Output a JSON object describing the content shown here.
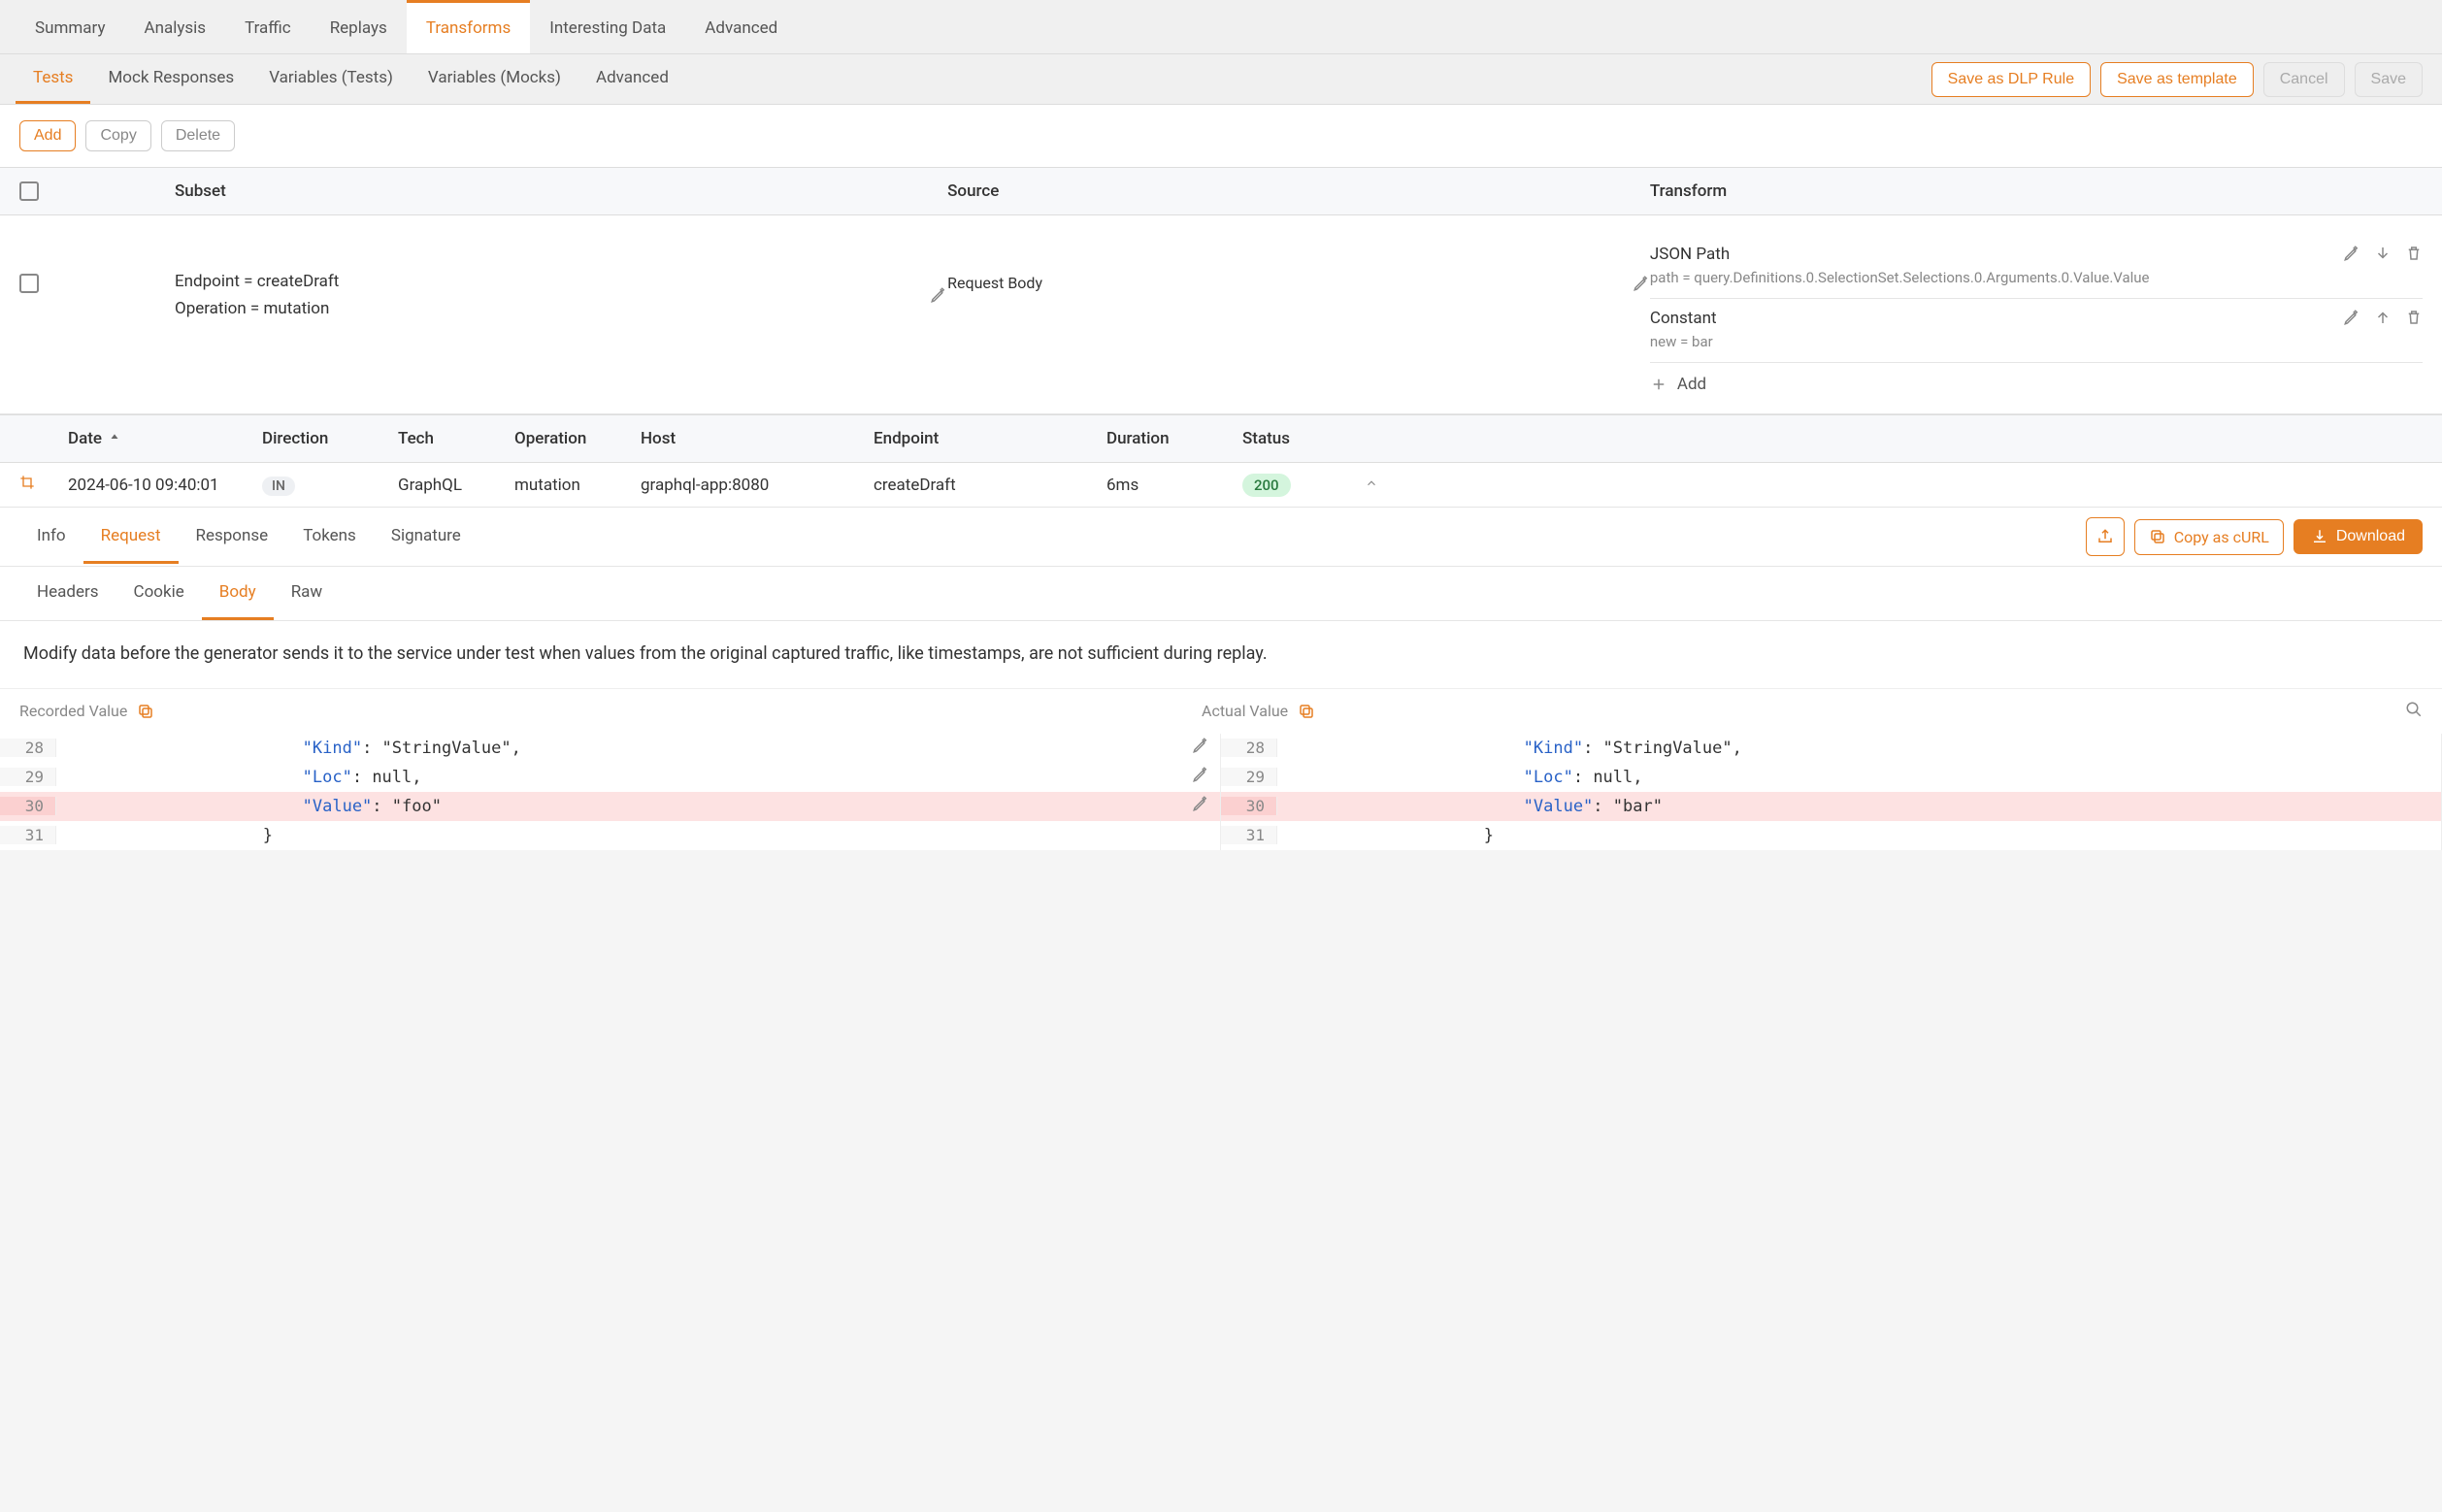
{
  "mainTabs": [
    "Summary",
    "Analysis",
    "Traffic",
    "Replays",
    "Transforms",
    "Interesting Data",
    "Advanced"
  ],
  "mainTabActive": "Transforms",
  "subTabs": [
    "Tests",
    "Mock Responses",
    "Variables (Tests)",
    "Variables (Mocks)",
    "Advanced"
  ],
  "subTabActive": "Tests",
  "actions": {
    "saveDlp": "Save as DLP Rule",
    "saveTemplate": "Save as template",
    "cancel": "Cancel",
    "save": "Save"
  },
  "toolbar": {
    "add": "Add",
    "copy": "Copy",
    "delete": "Delete"
  },
  "tableHeaders": {
    "subset": "Subset",
    "source": "Source",
    "transform": "Transform"
  },
  "row": {
    "subset": {
      "endpoint": "Endpoint = createDraft",
      "operation": "Operation = mutation"
    },
    "source": "Request Body",
    "transforms": [
      {
        "title": "JSON Path",
        "sub": "path = query.Definitions.0.SelectionSet.Selections.0.Arguments.0.Value.Value"
      },
      {
        "title": "Constant",
        "sub": "new = bar"
      }
    ],
    "addLabel": "Add"
  },
  "resultHeaders": {
    "date": "Date",
    "direction": "Direction",
    "tech": "Tech",
    "operation": "Operation",
    "host": "Host",
    "endpoint": "Endpoint",
    "duration": "Duration",
    "status": "Status"
  },
  "resultRow": {
    "date": "2024-06-10 09:40:01",
    "direction": "IN",
    "tech": "GraphQL",
    "operation": "mutation",
    "host": "graphql-app:8080",
    "endpoint": "createDraft",
    "duration": "6ms",
    "status": "200"
  },
  "detailTabs": [
    "Info",
    "Request",
    "Response",
    "Tokens",
    "Signature"
  ],
  "detailTabActive": "Request",
  "detailActions": {
    "copyCurl": "Copy as cURL",
    "download": "Download"
  },
  "bodyTabs": [
    "Headers",
    "Cookie",
    "Body",
    "Raw"
  ],
  "bodyTabActive": "Body",
  "description": "Modify data before the generator sends it to the service under test when values from the original captured traffic, like timestamps, are not sufficient during replay.",
  "diff": {
    "recordedLabel": "Recorded Value",
    "actualLabel": "Actual Value",
    "recorded": [
      {
        "num": "28",
        "indent": 24,
        "key": "Kind",
        "val": "\"StringValue\"",
        "comma": true,
        "hl": false,
        "edit": true
      },
      {
        "num": "29",
        "indent": 24,
        "key": "Loc",
        "val": "null",
        "comma": true,
        "hl": false,
        "edit": true
      },
      {
        "num": "30",
        "indent": 24,
        "key": "Value",
        "val": "\"foo\"",
        "comma": false,
        "hl": true,
        "edit": true
      },
      {
        "num": "31",
        "indent": 20,
        "raw": "}",
        "hl": false,
        "edit": false
      }
    ],
    "actual": [
      {
        "num": "28",
        "indent": 24,
        "key": "Kind",
        "val": "\"StringValue\"",
        "comma": true,
        "hl": false
      },
      {
        "num": "29",
        "indent": 24,
        "key": "Loc",
        "val": "null",
        "comma": true,
        "hl": false
      },
      {
        "num": "30",
        "indent": 24,
        "key": "Value",
        "val": "\"bar\"",
        "comma": false,
        "hl": true
      },
      {
        "num": "31",
        "indent": 20,
        "raw": "}",
        "hl": false
      }
    ]
  }
}
